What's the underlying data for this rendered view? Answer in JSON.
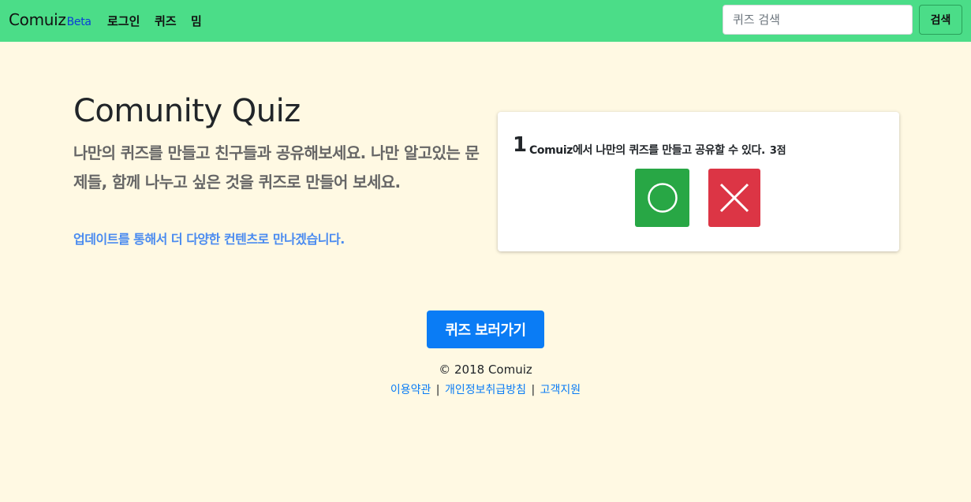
{
  "navbar": {
    "brand": "Comuiz",
    "brand_badge": "Beta",
    "links": [
      "로그인",
      "퀴즈",
      "밈"
    ],
    "search_placeholder": "퀴즈 검색",
    "search_value": "",
    "search_button": "검색",
    "background_color": "#4bdd88"
  },
  "hero": {
    "title": "Comunity Quiz",
    "lead": "나만의 퀴즈를 만들고 친구들과 공유해보세요. 나만 알고있는 문제들, 함께 나누고 싶은 것을 퀴즈로 만들어 보세요.",
    "update_note": "업데이트를 통해서 더 다양한 컨텐츠로 만나겠습니다."
  },
  "quiz_card": {
    "number": "1",
    "question": "Comuiz에서 나만의 퀴즈를 만들고 공유할 수 있다.",
    "points": "3점",
    "true_icon": "circle-icon",
    "false_icon": "x-icon",
    "true_color": "#28a745",
    "false_color": "#dc3545"
  },
  "cta": {
    "label": "퀴즈 보러가기",
    "color": "#0a7cf5"
  },
  "footer": {
    "copyright": "© 2018 Comuiz",
    "links": [
      "이용약관",
      "개인정보취급방침",
      "고객지원"
    ],
    "separator": "|"
  },
  "page_background": "#fff9e3"
}
